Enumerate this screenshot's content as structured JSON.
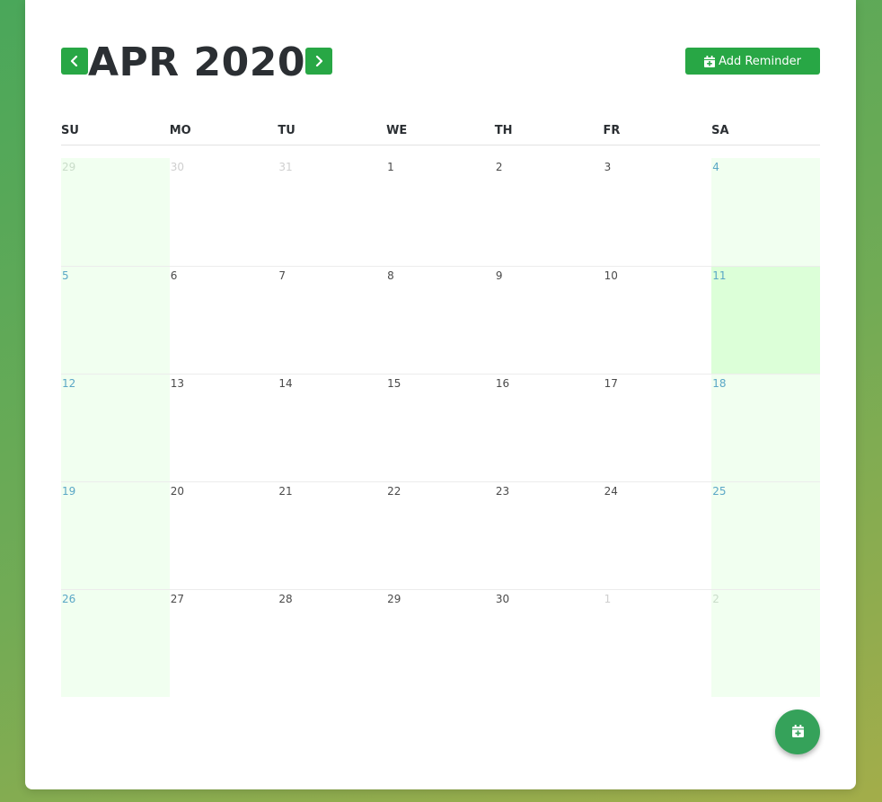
{
  "calendar": {
    "month_title": "APR 2020",
    "add_reminder_label": "Add Reminder",
    "weekdays": [
      "SU",
      "MO",
      "TU",
      "WE",
      "TH",
      "FR",
      "SA"
    ],
    "weeks": [
      [
        {
          "day": "29",
          "other": true,
          "weekend": true
        },
        {
          "day": "30",
          "other": true
        },
        {
          "day": "31",
          "other": true
        },
        {
          "day": "1"
        },
        {
          "day": "2"
        },
        {
          "day": "3"
        },
        {
          "day": "4",
          "weekend": true
        }
      ],
      [
        {
          "day": "5",
          "weekend": true
        },
        {
          "day": "6"
        },
        {
          "day": "7"
        },
        {
          "day": "8"
        },
        {
          "day": "9"
        },
        {
          "day": "10"
        },
        {
          "day": "11",
          "weekend": true,
          "today": true
        }
      ],
      [
        {
          "day": "12",
          "weekend": true
        },
        {
          "day": "13"
        },
        {
          "day": "14"
        },
        {
          "day": "15"
        },
        {
          "day": "16"
        },
        {
          "day": "17"
        },
        {
          "day": "18",
          "weekend": true
        }
      ],
      [
        {
          "day": "19",
          "weekend": true
        },
        {
          "day": "20"
        },
        {
          "day": "21"
        },
        {
          "day": "22"
        },
        {
          "day": "23"
        },
        {
          "day": "24"
        },
        {
          "day": "25",
          "weekend": true
        }
      ],
      [
        {
          "day": "26",
          "weekend": true
        },
        {
          "day": "27"
        },
        {
          "day": "28"
        },
        {
          "day": "29"
        },
        {
          "day": "30"
        },
        {
          "day": "1",
          "other": true
        },
        {
          "day": "2",
          "other": true,
          "weekend": true
        }
      ]
    ]
  },
  "icons": {
    "prev": "chevron-left-icon",
    "next": "chevron-right-icon",
    "add": "calendar-plus-icon",
    "fab": "calendar-plus-icon"
  },
  "colors": {
    "accent": "#28a745",
    "weekend_bg": "#f1fff0",
    "today_bg": "#dcffd8",
    "weekend_text": "#5aa7c6"
  }
}
